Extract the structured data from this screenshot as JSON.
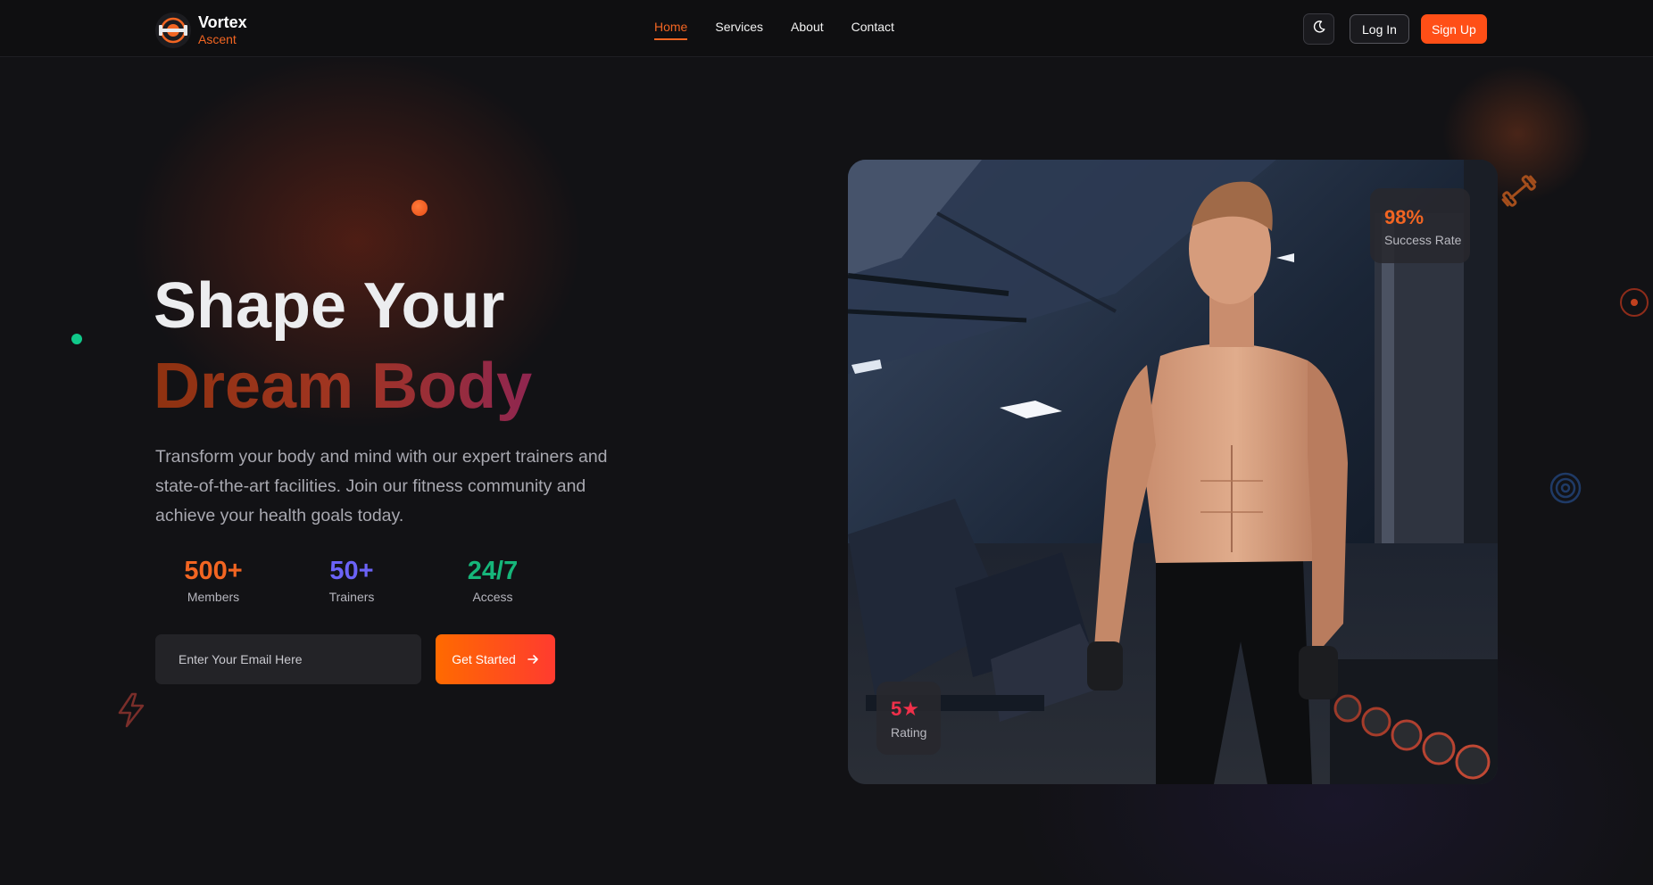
{
  "brand": {
    "name": "Vortex",
    "subtitle": "Ascent"
  },
  "nav": {
    "links": [
      {
        "label": "Home",
        "active": true
      },
      {
        "label": "Services",
        "active": false
      },
      {
        "label": "About",
        "active": false
      },
      {
        "label": "Contact",
        "active": false
      }
    ],
    "theme_icon": "moon-icon",
    "login_label": "Log In",
    "signup_label": "Sign Up"
  },
  "hero": {
    "title_line1": "Shape Your",
    "title_line2": "Dream Body",
    "description": "Transform your body and mind with our expert trainers and state-of-the-art facilities. Join our fitness community and achieve your health goals today.",
    "stats": [
      {
        "value": "500+",
        "label": "Members",
        "color": "#f26522"
      },
      {
        "value": "50+",
        "label": "Trainers",
        "color": "#6b63f6"
      },
      {
        "value": "24/7",
        "label": "Access",
        "color": "#16b67a"
      }
    ],
    "email_placeholder": "Enter Your Email Here",
    "cta_label": "Get Started",
    "cta_icon": "arrow-right-icon"
  },
  "badges": {
    "success": {
      "value": "98%",
      "label": "Success Rate",
      "color": "#f26522"
    },
    "rating": {
      "value": "5★",
      "label": "Rating",
      "color": "#f0304a"
    }
  },
  "decor_icons": [
    "dumbbell-icon",
    "target-icon",
    "concentric-circles-icon",
    "lightning-icon"
  ],
  "colors": {
    "accent": "#f26522",
    "background": "#121215",
    "signup": "#ff4f17"
  }
}
